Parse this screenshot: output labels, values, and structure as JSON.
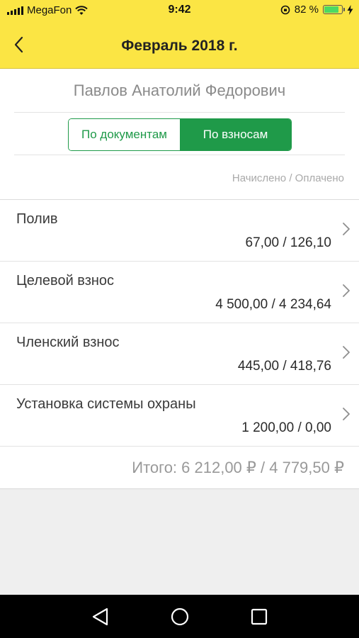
{
  "status_bar": {
    "carrier": "MegaFon",
    "time": "9:42",
    "battery_percent": "82 %",
    "battery_level": 0.82
  },
  "nav": {
    "title": "Февраль 2018 г."
  },
  "person": {
    "name": "Павлов Анатолий Федорович"
  },
  "segmented": {
    "left_label": "По документам",
    "right_label": "По взносам",
    "selected": "right"
  },
  "legend": "Начислено / Оплачено",
  "items": [
    {
      "name": "Полив",
      "amount": "67,00 / 126,10"
    },
    {
      "name": "Целевой взнос",
      "amount": "4 500,00 / 4 234,64"
    },
    {
      "name": "Членский взнос",
      "amount": "445,00 / 418,76"
    },
    {
      "name": "Установка системы охраны",
      "amount": "1 200,00 / 0,00"
    }
  ],
  "total": "Итого: 6 212,00 ₽ / 4 779,50 ₽",
  "colors": {
    "header": "#fbe544",
    "accent_green": "#1f9a49"
  }
}
